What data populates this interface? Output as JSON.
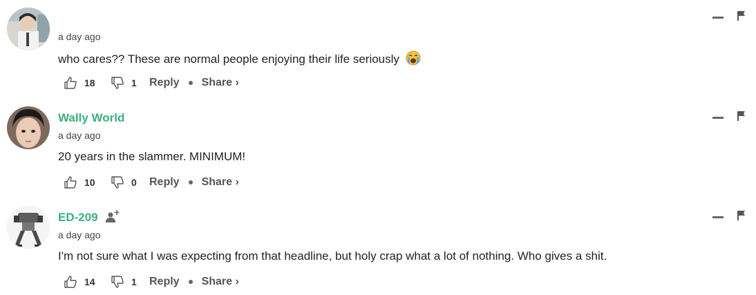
{
  "comments": [
    {
      "username": "",
      "timestamp": "a day ago",
      "text": "who cares?? These are normal people enjoying their life seriously",
      "emoji_icon": "loudly-crying-face-emoji",
      "likes": "18",
      "dislikes": "1",
      "reply_label": "Reply",
      "share_label": "Share ›"
    },
    {
      "username": "Wally World",
      "timestamp": "a day ago",
      "text": "20 years in the slammer. MINIMUM!",
      "likes": "10",
      "dislikes": "0",
      "reply_label": "Reply",
      "share_label": "Share ›"
    },
    {
      "username": "ED-209",
      "timestamp": "a day ago",
      "text": "I'm not sure what I was expecting from that headline, but holy crap what a lot of nothing. Who gives a shit.",
      "likes": "14",
      "dislikes": "1",
      "reply_label": "Reply",
      "share_label": "Share ›",
      "badge_icon": "follow-user-icon"
    }
  ],
  "colors": {
    "username": "#3bb07d",
    "text": "#222222",
    "muted": "#555555"
  },
  "icons": [
    "thumbs-up-icon",
    "thumbs-down-icon",
    "minimize-icon",
    "flag-icon"
  ]
}
